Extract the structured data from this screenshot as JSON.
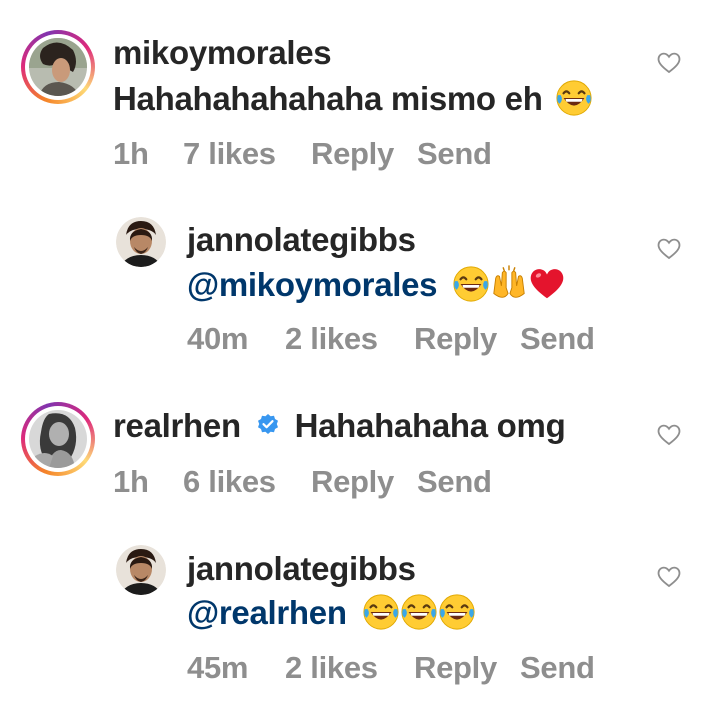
{
  "comments": [
    {
      "username": "mikoymorales",
      "text": "Hahahahahahaha mismo eh",
      "emoji": [
        "face-with-tears-of-joy"
      ],
      "time": "1h",
      "likes": "7 likes",
      "reply": "Reply",
      "send": "Send",
      "has_story_ring": true
    },
    {
      "username": "jannolategibbs",
      "mention": "@mikoymorales",
      "emoji": [
        "face-with-tears-of-joy",
        "raising-hands",
        "red-heart"
      ],
      "time": "40m",
      "likes": "2 likes",
      "reply": "Reply",
      "send": "Send",
      "is_reply": true
    },
    {
      "username": "realrhen",
      "verified": true,
      "text": "Hahahahaha omg",
      "time": "1h",
      "likes": "6 likes",
      "reply": "Reply",
      "send": "Send",
      "has_story_ring": true
    },
    {
      "username": "jannolategibbs",
      "mention": "@realrhen",
      "emoji": [
        "face-with-tears-of-joy",
        "face-with-tears-of-joy",
        "face-with-tears-of-joy"
      ],
      "time": "45m",
      "likes": "2 likes",
      "reply": "Reply",
      "send": "Send",
      "is_reply": true
    }
  ],
  "colors": {
    "text": "#262626",
    "meta": "#8e8e8e",
    "mention": "#00376b",
    "verified": "#3897f0",
    "heart_outline": "#8e8e8e"
  }
}
